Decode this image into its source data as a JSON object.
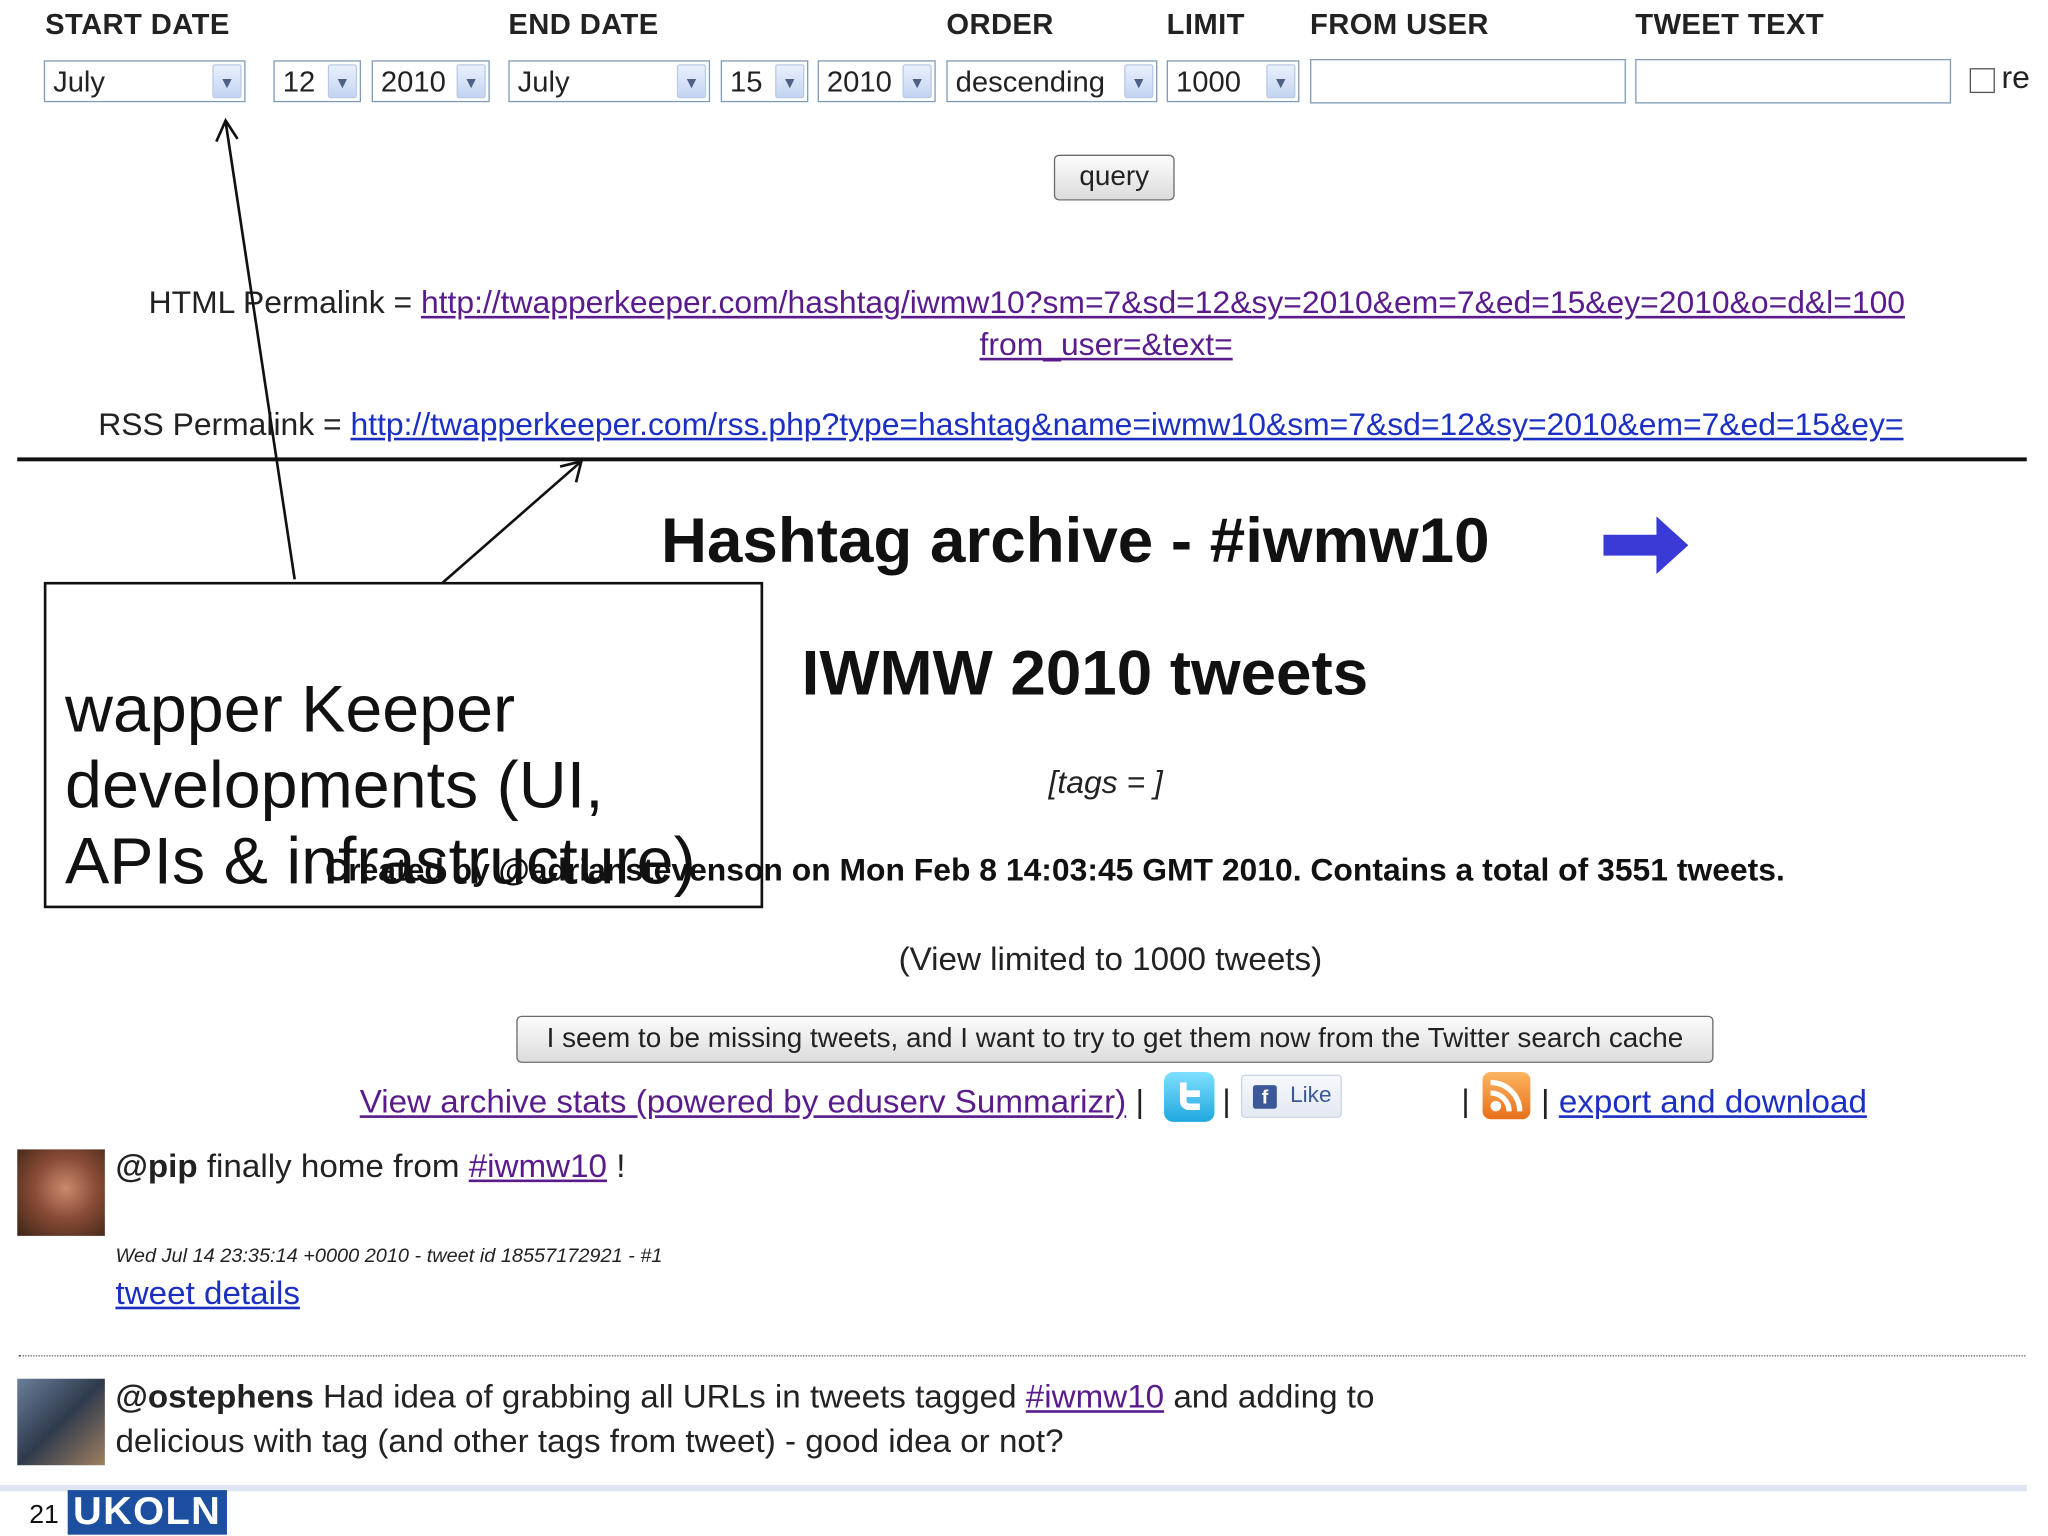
{
  "filters": {
    "headers": {
      "start_date": "START DATE",
      "end_date": "END DATE",
      "order": "ORDER",
      "limit": "LIMIT",
      "from_user": "FROM USER",
      "tweet_text": "TWEET TEXT"
    },
    "start_month": "July",
    "start_day": "12",
    "start_year": "2010",
    "end_month": "July",
    "end_day": "15",
    "end_year": "2010",
    "order": "descending",
    "limit": "1000",
    "from_user_value": "",
    "tweet_text_value": "",
    "checkbox_label": "re",
    "query_label": "query"
  },
  "permalinks": {
    "html_label": "HTML Permalink = ",
    "html_url_line1": "http://twapperkeeper.com/hashtag/iwmw10?sm=7&sd=12&sy=2010&em=7&ed=15&ey=2010&o=d&l=100",
    "html_url_line2": "from_user=&text=",
    "rss_label": "RSS Permalink = ",
    "rss_url": "http://twapperkeeper.com/rss.php?type=hashtag&name=iwmw10&sm=7&sd=12&sy=2010&em=7&ed=15&ey="
  },
  "archive": {
    "title": "Hashtag archive - #iwmw10",
    "subtitle": "IWMW 2010 tweets",
    "tags": "[tags = ]",
    "created": "Created by @adrianstevenson on Mon Feb 8 14:03:45 GMT 2010. Contains a total of 3551 tweets.",
    "view_limited": "(View limited to 1000 tweets)",
    "missing_button": "I seem to be missing tweets, and I want to try to get them now from the Twitter search cache",
    "stats_link": "View archive stats (powered by eduserv Summarizr)",
    "separator": "|",
    "like_label": "Like",
    "export_link": "export and download"
  },
  "tweets": [
    {
      "user": "@pip",
      "text_before": " finally home from ",
      "hashtag": "#iwmw10",
      "text_after": " !",
      "meta": "Wed Jul 14 23:35:14 +0000 2010 - tweet id 18557172921 - #1",
      "details_link": "tweet details"
    },
    {
      "user": "@ostephens",
      "text_before": " Had idea of grabbing all URLs in tweets tagged ",
      "hashtag": "#iwmw10",
      "text_after": " and adding to",
      "line2": "delicious with tag (and other tags from tweet) - good idea or not?"
    }
  ],
  "callout": {
    "text": "wapper Keeper developments (UI, APIs & infrastructure)"
  },
  "footer": {
    "slide_number": "21",
    "logo": "UKOLN"
  },
  "colors": {
    "link_visited": "#5a1c8c",
    "link": "#1b2fc3",
    "arrow_blue": "#3a3ad6",
    "twitter_blue": "#33ccff",
    "facebook_blue": "#3b5998",
    "rss_orange": "#f08a24",
    "ukoln_blue": "#1c4fa0"
  },
  "icons": [
    "chevron-down-icon",
    "arrow-right-icon",
    "twitter-icon",
    "facebook-icon",
    "rss-icon"
  ]
}
